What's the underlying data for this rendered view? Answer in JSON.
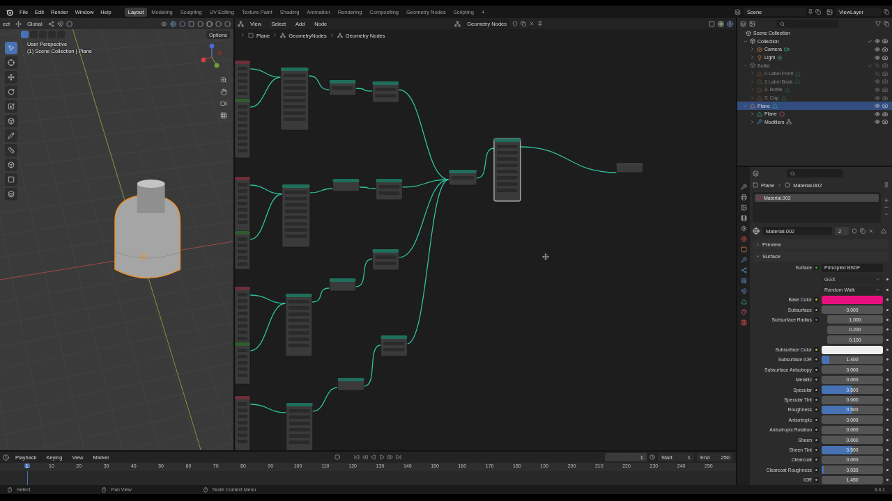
{
  "topbar": {
    "menus": [
      "File",
      "Edit",
      "Render",
      "Window",
      "Help"
    ],
    "workspaces": [
      {
        "label": "Layout",
        "selected": true
      },
      {
        "label": "Modeling",
        "selected": false
      },
      {
        "label": "Sculpting",
        "selected": false
      },
      {
        "label": "UV Editing",
        "selected": false
      },
      {
        "label": "Texture Paint",
        "selected": false
      },
      {
        "label": "Shading",
        "selected": false
      },
      {
        "label": "Animation",
        "selected": false
      },
      {
        "label": "Rendering",
        "selected": false
      },
      {
        "label": "Compositing",
        "selected": false
      },
      {
        "label": "Geometry Nodes",
        "selected": false
      },
      {
        "label": "Scripting",
        "selected": false
      }
    ],
    "add_workspace": "+",
    "scene": "Scene",
    "view_layer": "ViewLayer"
  },
  "viewport": {
    "mode": "ect",
    "orientation": "Global",
    "options": "Options",
    "view_name": "User Perspective",
    "view_info": "(1) Scene Collection | Plane"
  },
  "node_editor": {
    "menus": [
      "View",
      "Select",
      "Add",
      "Node"
    ],
    "node_group": "Geometry Nodes",
    "breadcrumbs": [
      "Plane",
      "GeometryNodes",
      "Geometry Nodes"
    ]
  },
  "outliner": {
    "root": "Scene Collection",
    "items": [
      {
        "name": "Collection",
        "kind": "collection",
        "expanded": true,
        "selected": false,
        "dimmed": false,
        "visible": true,
        "children": [
          {
            "name": "Camera",
            "kind": "camera",
            "expanded": false,
            "selected": false,
            "dimmed": false,
            "visible": true
          },
          {
            "name": "Light",
            "kind": "light",
            "expanded": false,
            "selected": false,
            "dimmed": false,
            "visible": true
          }
        ]
      },
      {
        "name": "Bottle",
        "kind": "collection",
        "expanded": true,
        "selected": false,
        "dimmed": true,
        "visible": false,
        "children": [
          {
            "name": "0 Label Front",
            "kind": "object",
            "expanded": false,
            "selected": false,
            "dimmed": true,
            "visible": false
          },
          {
            "name": "1 Label Back",
            "kind": "object",
            "expanded": false,
            "selected": false,
            "dimmed": true,
            "visible": true
          },
          {
            "name": "2. Bottle",
            "kind": "object",
            "expanded": false,
            "selected": false,
            "dimmed": true,
            "visible": true
          },
          {
            "name": "3. Cap",
            "kind": "object",
            "expanded": false,
            "selected": false,
            "dimmed": true,
            "visible": true
          }
        ]
      },
      {
        "name": "Plane",
        "kind": "object",
        "expanded": true,
        "selected": true,
        "dimmed": false,
        "visible": true,
        "children": [
          {
            "name": "Plane",
            "kind": "mesh",
            "expanded": false,
            "selected": false,
            "dimmed": false,
            "visible": true
          },
          {
            "name": "Modifiers",
            "kind": "modifiers",
            "expanded": false,
            "selected": false,
            "dimmed": false,
            "visible": true
          }
        ]
      }
    ]
  },
  "properties": {
    "breadcrumbs": [
      "Plane",
      "Material.002"
    ],
    "slots": [
      {
        "name": "Material.002",
        "selected": true
      }
    ],
    "material": "Material.002",
    "users": "2",
    "panels": [
      {
        "title": "Preview",
        "expanded": false
      },
      {
        "title": "Surface",
        "expanded": true,
        "surface_label": "Surface",
        "surface": "Principled BSDF",
        "distribution": "GGX",
        "subsurface_method": "Random Walk",
        "fields": [
          {
            "label": "Base Color",
            "kind": "color",
            "color": "#e8107e"
          },
          {
            "label": "Subsurface",
            "kind": "slider",
            "value": "0.000",
            "level": 0
          },
          {
            "label": "Subsurface Radius",
            "kind": "vector",
            "values": [
              "1.000",
              "0.200",
              "0.100"
            ]
          },
          {
            "label": "Subsurface Color",
            "kind": "color",
            "color": "#efefef"
          },
          {
            "label": "Subsurface IOR",
            "kind": "slider",
            "value": "1.400",
            "level": 0.13
          },
          {
            "label": "Subsurface Anisotropy",
            "kind": "slider",
            "value": "0.000",
            "level": 0
          },
          {
            "label": "Metallic",
            "kind": "slider",
            "value": "0.000",
            "level": 0
          },
          {
            "label": "Specular",
            "kind": "slider",
            "value": "0.500",
            "level": 0.5
          },
          {
            "label": "Specular Tint",
            "kind": "slider",
            "value": "0.000",
            "level": 0
          },
          {
            "label": "Roughness",
            "kind": "slider",
            "value": "0.500",
            "level": 0.5
          },
          {
            "label": "Anisotropic",
            "kind": "slider",
            "value": "0.000",
            "level": 0
          },
          {
            "label": "Anisotropic Rotation",
            "kind": "slider",
            "value": "0.000",
            "level": 0
          },
          {
            "label": "Sheen",
            "kind": "slider",
            "value": "0.000",
            "level": 0
          },
          {
            "label": "Sheen Tint",
            "kind": "slider",
            "value": "0.500",
            "level": 0.5
          },
          {
            "label": "Clearcoat",
            "kind": "slider",
            "value": "0.000",
            "level": 0
          },
          {
            "label": "Clearcoat Roughness",
            "kind": "slider",
            "value": "0.030",
            "level": 0.03
          },
          {
            "label": "IOR",
            "kind": "number",
            "value": "1.450"
          }
        ]
      }
    ]
  },
  "timeline": {
    "menus": [
      "Playback",
      "Keying",
      "View",
      "Marker"
    ],
    "current_frame": "1",
    "start_label": "Start",
    "start": "1",
    "end_label": "End",
    "end": "250",
    "ticks": [
      {
        "label": "1",
        "selected": true
      },
      {
        "label": "10",
        "selected": false
      },
      {
        "label": "20",
        "selected": false
      },
      {
        "label": "30",
        "selected": false
      },
      {
        "label": "40",
        "selected": false
      },
      {
        "label": "50",
        "selected": false
      },
      {
        "label": "60",
        "selected": false
      },
      {
        "label": "70",
        "selected": false
      },
      {
        "label": "80",
        "selected": false
      },
      {
        "label": "90",
        "selected": false
      },
      {
        "label": "100",
        "selected": false
      },
      {
        "label": "110",
        "selected": false
      },
      {
        "label": "120",
        "selected": false
      },
      {
        "label": "130",
        "selected": false
      },
      {
        "label": "140",
        "selected": false
      },
      {
        "label": "150",
        "selected": false
      },
      {
        "label": "160",
        "selected": false
      },
      {
        "label": "170",
        "selected": false
      },
      {
        "label": "180",
        "selected": false
      },
      {
        "label": "190",
        "selected": false
      },
      {
        "label": "200",
        "selected": false
      },
      {
        "label": "210",
        "selected": false
      },
      {
        "label": "220",
        "selected": false
      },
      {
        "label": "230",
        "selected": false
      },
      {
        "label": "240",
        "selected": false
      },
      {
        "label": "250",
        "selected": false
      }
    ]
  },
  "status_bar": {
    "hints": [
      "Select",
      "Pan View",
      "Node Context Menu"
    ],
    "version": "3.3.1"
  }
}
